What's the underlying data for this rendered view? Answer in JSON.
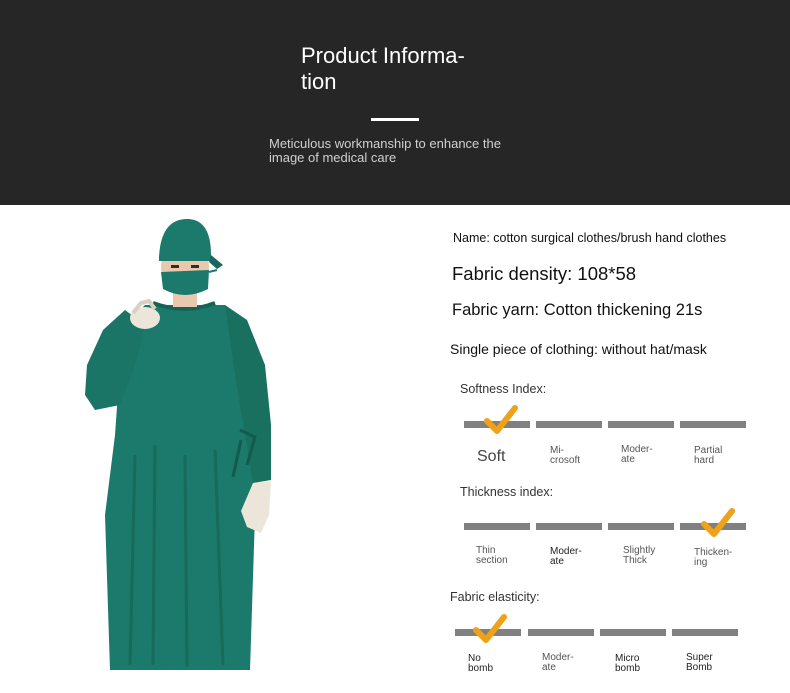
{
  "banner": {
    "title": "Product Informa- tion",
    "subtitle": "Meticulous workmanship to enhance the image of medical care"
  },
  "product": {
    "name": "Name: cotton surgical clothes/brush hand clothes",
    "density": "Fabric density: 108*58",
    "yarn": "Fabric yarn: Cotton thickening 21s",
    "piece": "Single piece of clothing: without hat/mask"
  },
  "softness": {
    "title": "Softness Index:",
    "levels": [
      "Soft",
      "Mi- crosoft",
      "Moder- ate",
      "Partial hard"
    ],
    "selected": "Soft"
  },
  "thickness": {
    "title": "Thickness index:",
    "levels": [
      "Thin section",
      "Moder- ate",
      "Slightly Thick",
      "Thicken- ing"
    ],
    "selected": "Thicken- ing"
  },
  "elasticity": {
    "title": "Fabric elasticity:",
    "levels": [
      "No bomb",
      "Moder- ate",
      "Micro bomb",
      "Super Bomb"
    ],
    "selected": "No bomb"
  },
  "colors": {
    "banner_bg": "#262626",
    "gown_green": "#1b7a6b",
    "bar_gray": "#808080",
    "check_orange": "#f0a11a"
  }
}
